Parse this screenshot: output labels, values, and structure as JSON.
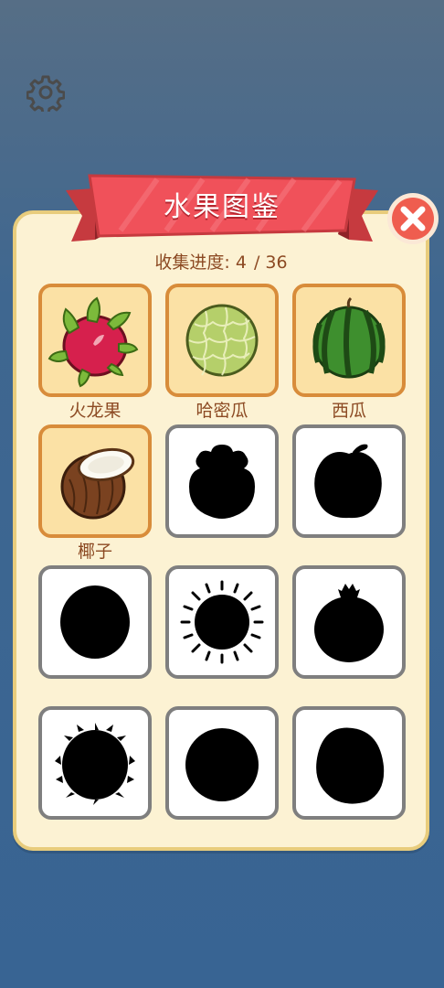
{
  "settings_icon": "gear-icon",
  "close_icon": "close-icon",
  "header": {
    "title": "水果图鉴"
  },
  "progress": {
    "label": "收集进度:",
    "collected": "4",
    "total": "36"
  },
  "colors": {
    "background": "#3f6790",
    "panel": "#fcf2d3",
    "ribbon": "#f0515a",
    "text": "#8c4a23",
    "unlocked_border": "#d88c3a",
    "locked_border": "#7f7f7f"
  },
  "fruits": [
    {
      "name": "火龙果",
      "icon": "dragon-fruit-icon",
      "unlocked": true
    },
    {
      "name": "哈密瓜",
      "icon": "cantaloupe-icon",
      "unlocked": true
    },
    {
      "name": "西瓜",
      "icon": "watermelon-icon",
      "unlocked": true
    },
    {
      "name": "椰子",
      "icon": "coconut-icon",
      "unlocked": true
    },
    {
      "name": "",
      "icon": "mangosteen-silhouette-icon",
      "unlocked": false
    },
    {
      "name": "",
      "icon": "apple-silhouette-icon",
      "unlocked": false
    },
    {
      "name": "",
      "icon": "round-fruit-silhouette-icon",
      "unlocked": false
    },
    {
      "name": "",
      "icon": "rambutan-silhouette-icon",
      "unlocked": false
    },
    {
      "name": "",
      "icon": "pomegranate-silhouette-icon",
      "unlocked": false
    },
    {
      "name": "",
      "icon": "durian-silhouette-icon",
      "unlocked": false
    },
    {
      "name": "",
      "icon": "orange-silhouette-icon",
      "unlocked": false
    },
    {
      "name": "",
      "icon": "peach-silhouette-icon",
      "unlocked": false
    }
  ]
}
